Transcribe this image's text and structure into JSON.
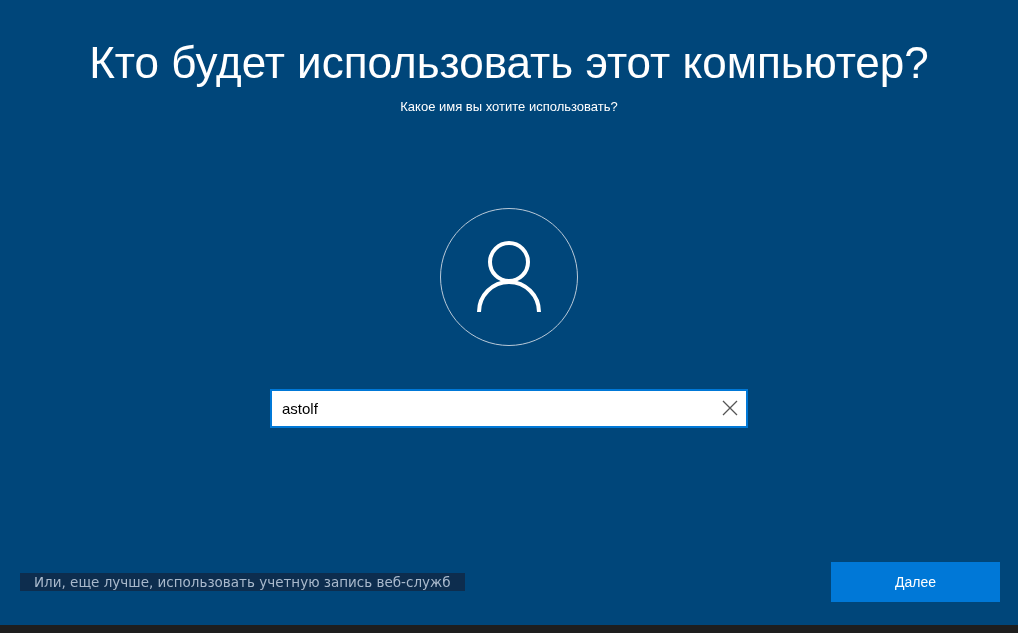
{
  "title": "Кто будет использовать этот компьютер?",
  "subtitle": "Какое имя вы хотите использовать?",
  "name_field": {
    "value": "astolf"
  },
  "alt_link": "Или, еще лучше, использовать учетную запись веб-служб",
  "buttons": [
    "Далее"
  ]
}
